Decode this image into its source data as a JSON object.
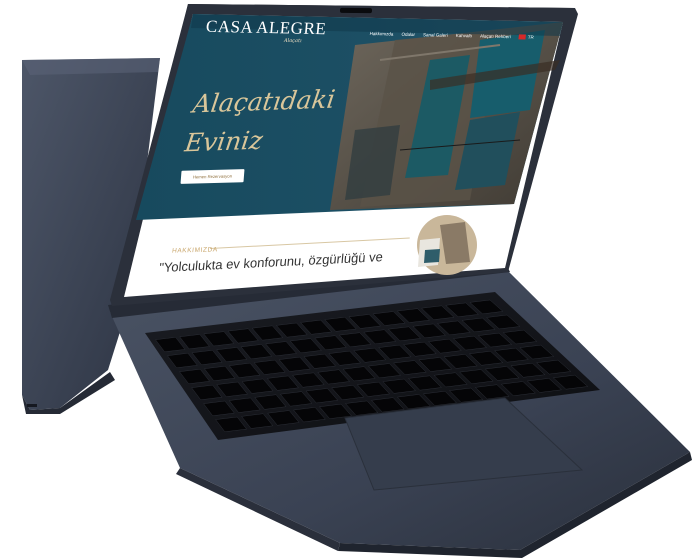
{
  "site": {
    "logo": "CASA ALEGRE",
    "logo_sub": "Alaçatı",
    "nav": [
      "Hakkımızda",
      "Odalar",
      "Sanal Galeri",
      "Kahvaltı",
      "Alaçatı Rehberi"
    ],
    "language": "TR",
    "hero_line1": "Alaçatıdaki",
    "hero_line2": "Eviniz",
    "reserve_button": "Hemen Rezervasyon",
    "about_label": "HAKKIMIZDA",
    "about_quote": "\"Yolculukta ev konforunu, özgürlüğü ve"
  },
  "colors": {
    "hero_teal": "#1d4e63",
    "gold": "#d9c69a",
    "laptop_body": "#3d4556",
    "keyboard": "#15161b"
  }
}
